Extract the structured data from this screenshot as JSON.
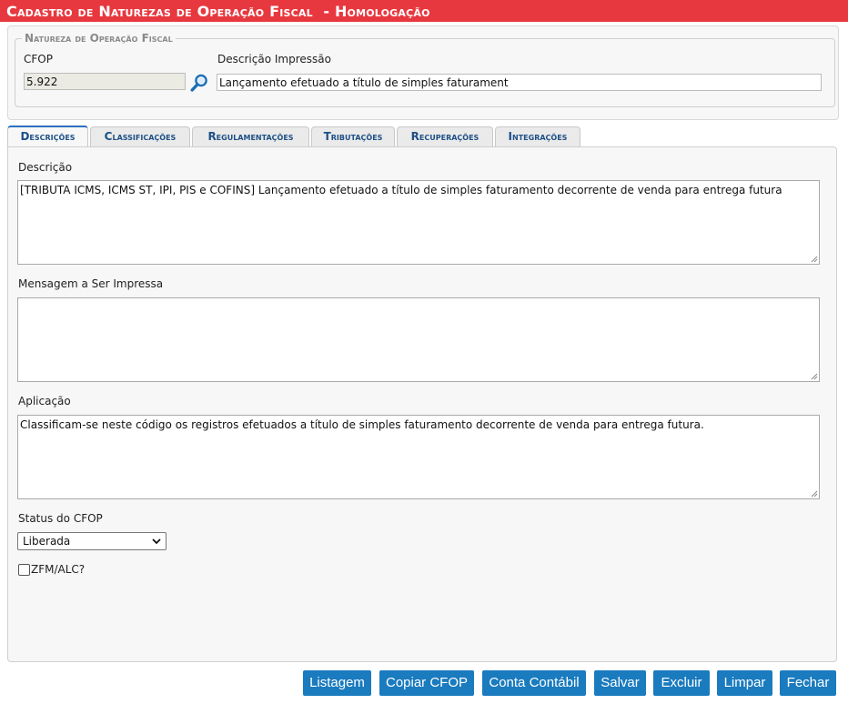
{
  "window": {
    "title": "Cadastro de Naturezas de Operação Fiscal  - Homologação"
  },
  "natureza": {
    "legend": "Natureza de Operação Fiscal",
    "cfop_label": "CFOP",
    "cfop_value": "5.922",
    "desc_impressao_label": "Descrição Impressão",
    "desc_impressao_value": "Lançamento efetuado a título de simples faturament"
  },
  "tabs": [
    {
      "label": "Descrições",
      "active": true
    },
    {
      "label": "Classificações",
      "active": false
    },
    {
      "label": "Regulamentações",
      "active": false
    },
    {
      "label": "Tributações",
      "active": false
    },
    {
      "label": "Recuperações",
      "active": false
    },
    {
      "label": "Integrações",
      "active": false
    }
  ],
  "form": {
    "descricao_label": "Descrição",
    "descricao_value": "[TRIBUTA ICMS, ICMS ST, IPI, PIS e COFINS] Lançamento efetuado a título de simples faturamento decorrente de venda para entrega futura",
    "mensagem_label": "Mensagem a Ser Impressa",
    "mensagem_value": "",
    "aplicacao_label": "Aplicação",
    "aplicacao_value": "Classificam-se neste código os registros efetuados a título de simples faturamento decorrente de venda para entrega futura.",
    "status_label": "Status do CFOP",
    "status_value": "Liberada",
    "zfm_label": "ZFM/ALC?",
    "zfm_checked": false
  },
  "buttons": {
    "listagem": "Listagem",
    "copiar": "Copiar CFOP",
    "conta": "Conta Contábil",
    "salvar": "Salvar",
    "excluir": "Excluir",
    "limpar": "Limpar",
    "fechar": "Fechar"
  },
  "colors": {
    "title_bar": "#e8383f",
    "button": "#1a7bbf",
    "tab_text": "#1d4f86"
  },
  "icons": {
    "lookup": "magnifier-icon",
    "status_dropdown": "chevron-down-icon",
    "resize": "resize-grip-icon"
  }
}
